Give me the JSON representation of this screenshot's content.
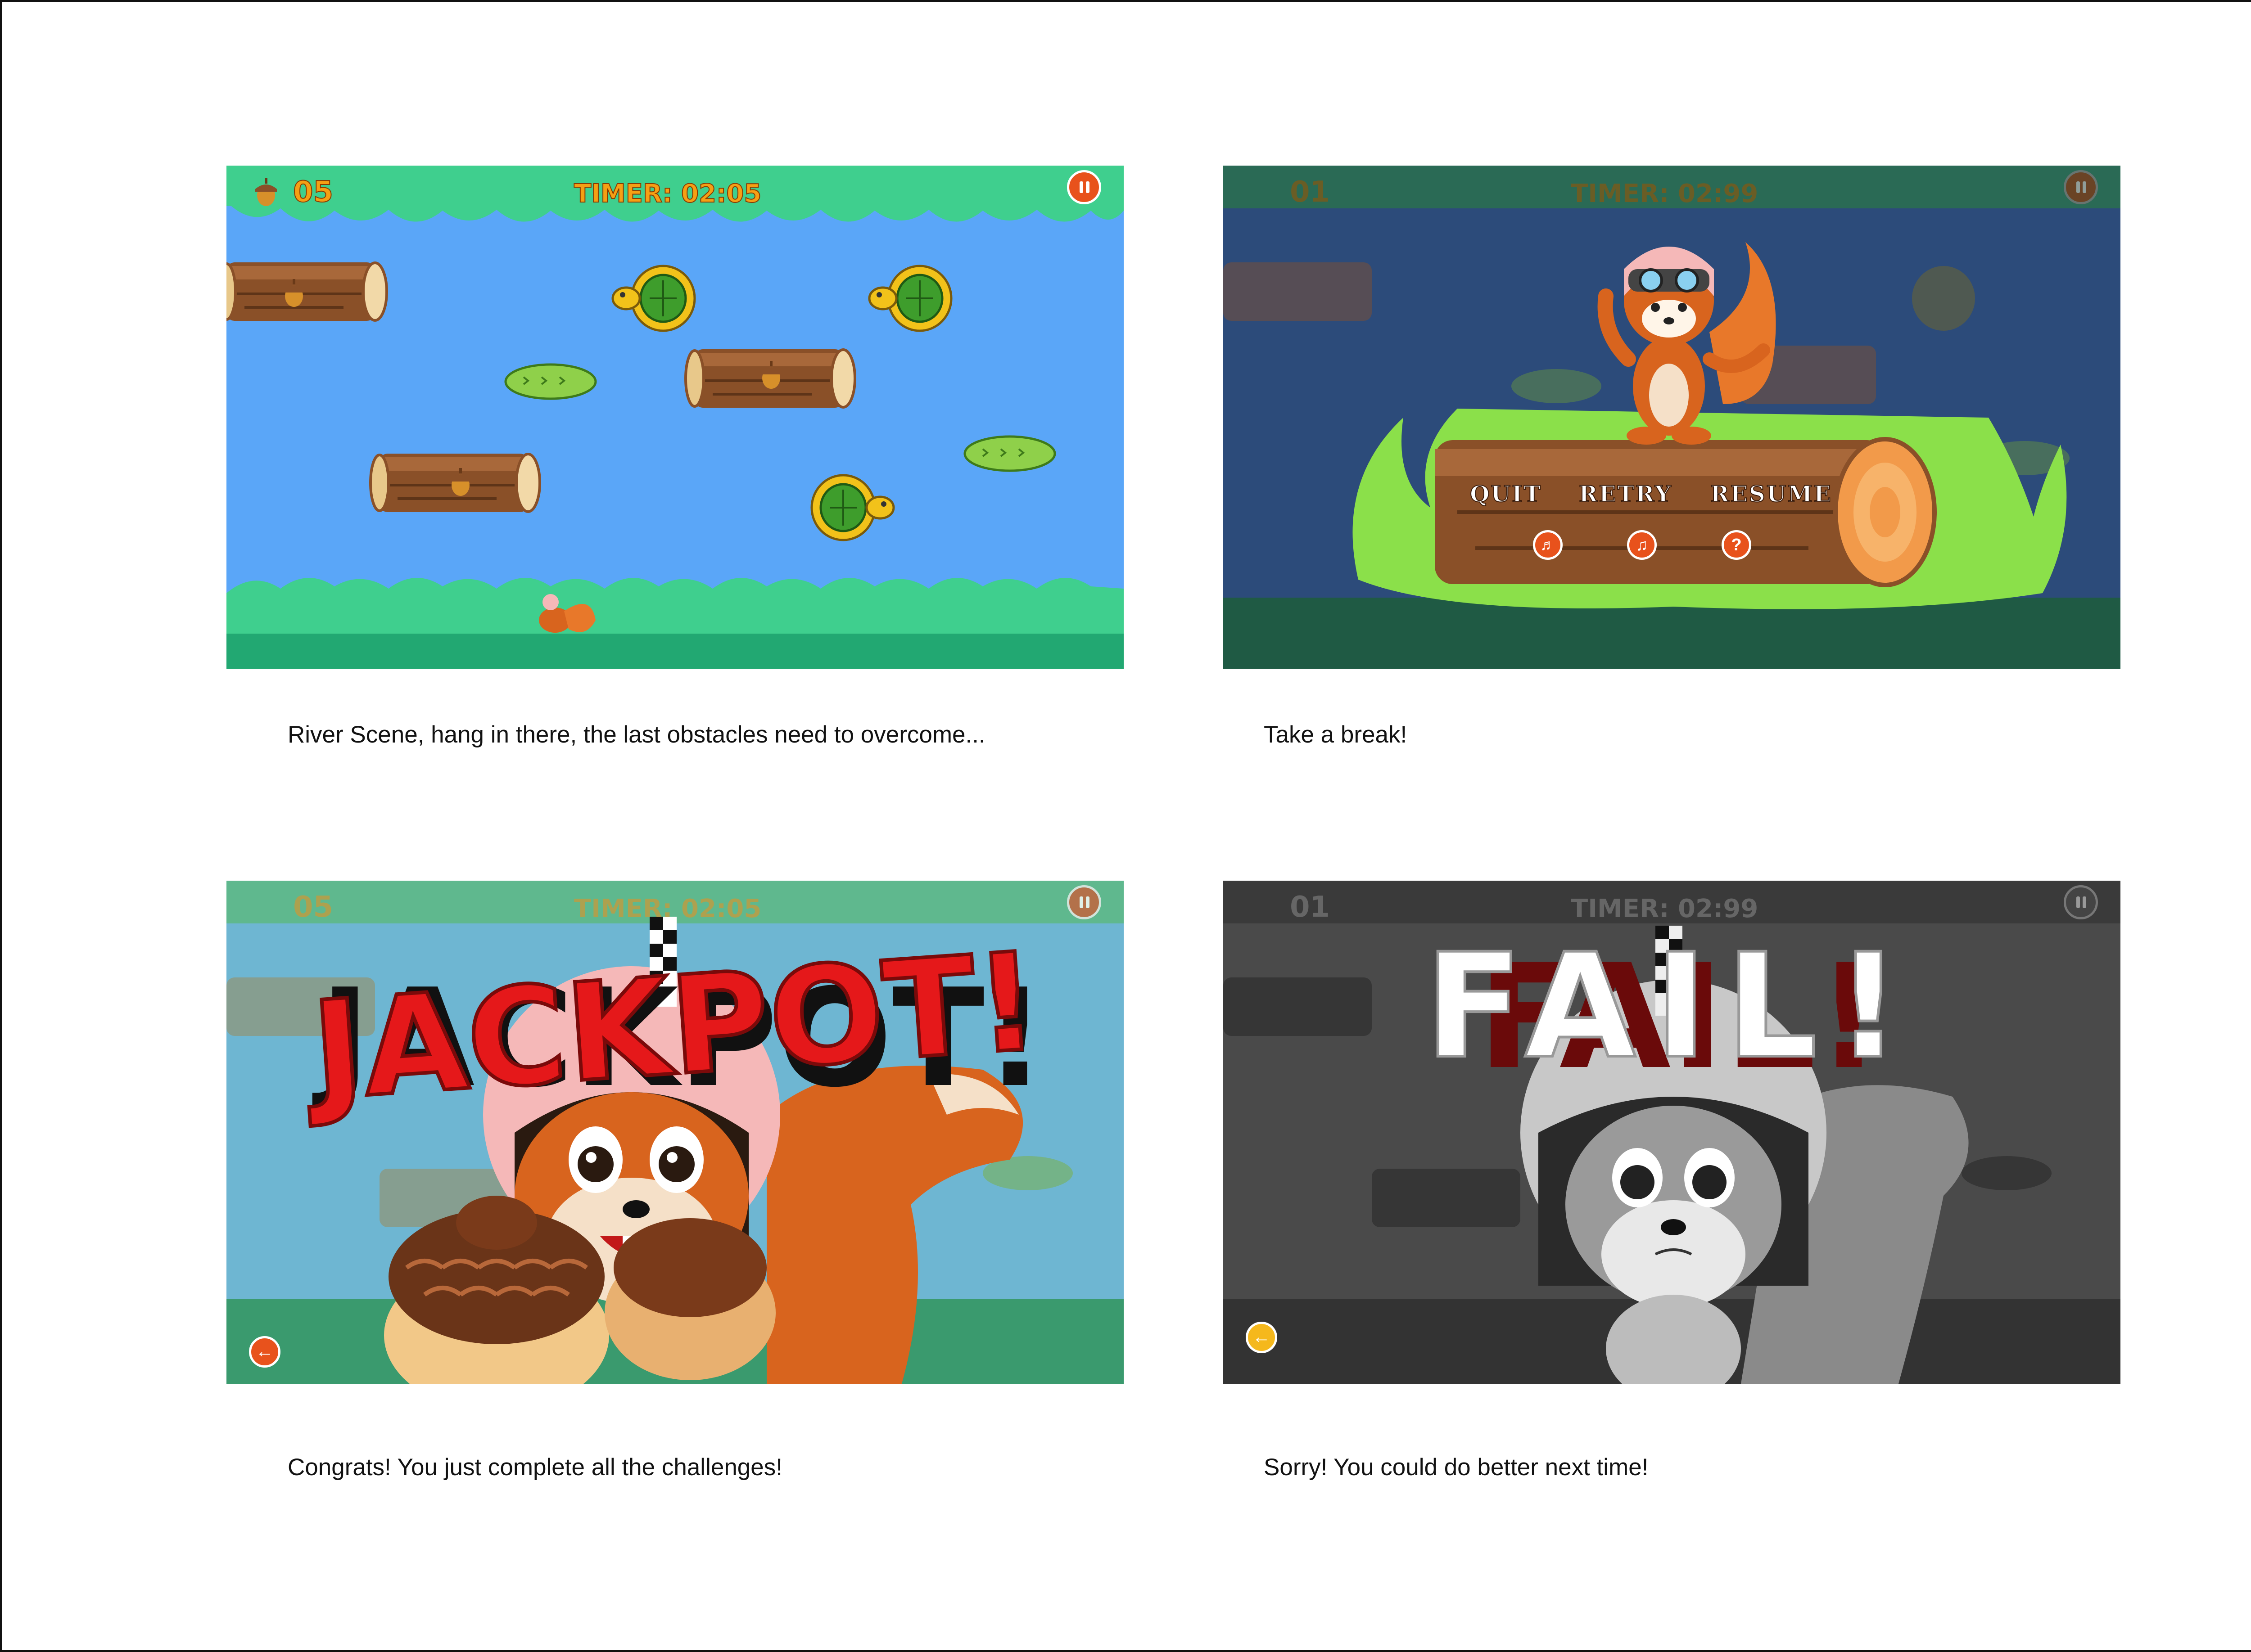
{
  "screens": {
    "river": {
      "acorn_count": "05",
      "timer": "TIMER: 02:05",
      "caption": "River Scene, hang in there, the last obstacles need to overcome..."
    },
    "pause": {
      "acorn_count": "01",
      "timer": "TIMER: 02:99",
      "menu": {
        "quit": "QUIT",
        "retry": "RETRY",
        "resume": "RESUME"
      },
      "caption": "Take a break!"
    },
    "jackpot": {
      "acorn_count": "05",
      "timer": "TIMER: 02:05",
      "banner": "JACKPOT!",
      "caption": "Congrats! You just complete all the challenges!"
    },
    "fail": {
      "acorn_count": "01",
      "timer": "TIMER: 02:99",
      "banner": "FAIL!",
      "caption": "Sorry! You could do better next time!"
    }
  },
  "icons": {
    "pause": "pause-icon",
    "acorn": "acorn-icon",
    "sound": "speaker-icon",
    "music": "music-note-icon",
    "help": "question-icon",
    "back": "back-arrow-icon"
  },
  "colors": {
    "river": "#5aa6f8",
    "grass": "#3fcf8e",
    "hud_orange": "#f5a014",
    "button_orange": "#e8521c",
    "log_brown": "#8a5028",
    "turtle_shell": "#3e9d2c",
    "banner_red": "#e5181a",
    "squirrel": "#d8641e"
  }
}
